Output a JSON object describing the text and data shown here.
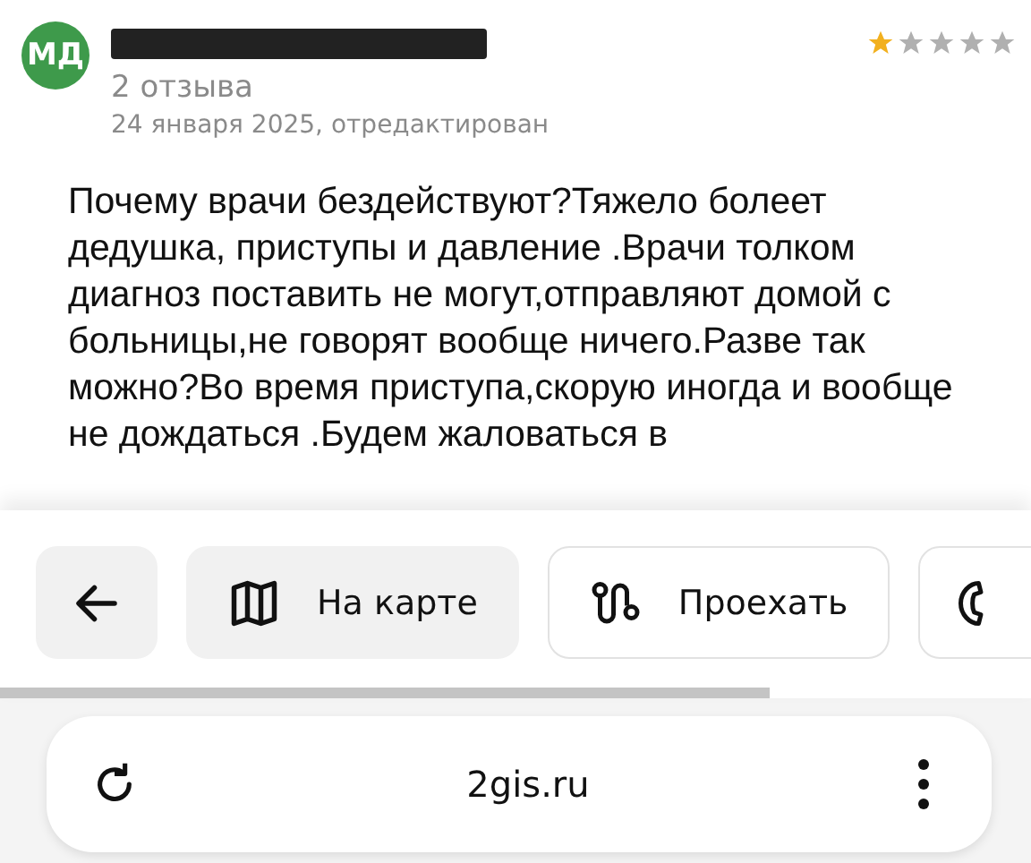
{
  "review": {
    "avatar": {
      "initials": "МД",
      "color": "#3e9a4b"
    },
    "review_count": "2 отзыва",
    "date": "24 января 2025, отредактирован",
    "stars": 1,
    "text": "Почему врачи бездействуют?Тяжело болеет дедушка, приступы и давление .Врачи толком диагноз поставить не могут,отправляют домой с больницы,не говорят вообще ничего.Разве так можно?Во время приступа,скорую иногда и вообще не дождаться .Будем жаловаться в"
  },
  "actions": [
    {
      "kind": "back",
      "filled": true
    },
    {
      "kind": "map",
      "label": "На карте",
      "filled": true
    },
    {
      "kind": "route",
      "label": "Проехать",
      "filled": false
    },
    {
      "kind": "call",
      "filled": false
    }
  ],
  "browser": {
    "url": "2gis.ru"
  }
}
